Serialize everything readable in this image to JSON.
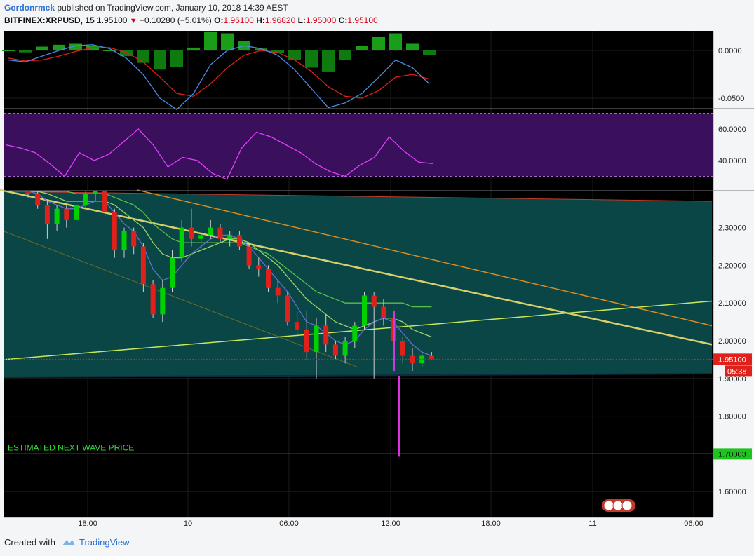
{
  "header": {
    "author": "Gordonrmck",
    "published_text": "published on TradingView.com, January 10, 2018 14:39 AEST",
    "symbol": "BITFINEX:XRPUSD, 15",
    "last": "1.95100",
    "change": "−0.10280 (−5.01%)",
    "o_label": "O:",
    "o_value": "1.96100",
    "h_label": "H:",
    "h_value": "1.96820",
    "l_label": "L:",
    "l_value": "1.95000",
    "c_label": "C:",
    "c_value": "1.95100"
  },
  "footer": {
    "created_with": "Created with",
    "brand": "TradingView"
  },
  "colors": {
    "up": "#00d100",
    "down": "#e0201b",
    "macd_line": "#4a8be0",
    "signal_line": "#e0201b",
    "hist": "#1a9e1a",
    "rsi": "#e040fb",
    "rsi_band": "#3a0f5c",
    "channel_fill": "#0b4a4a",
    "price_tag": "#e0201b",
    "target_tag": "#1ec41e"
  },
  "macd_pane": {
    "ticks": [
      "0.0000",
      "-0.0500"
    ],
    "macd": [
      -0.01,
      -0.012,
      -0.006,
      0.0,
      0.005,
      0.006,
      0.002,
      -0.008,
      -0.025,
      -0.05,
      -0.062,
      -0.045,
      -0.015,
      0.0,
      0.005,
      0.002,
      -0.005,
      -0.02,
      -0.04,
      -0.06,
      -0.055,
      -0.045,
      -0.028,
      -0.01,
      -0.018,
      -0.035
    ],
    "signal": [
      -0.008,
      -0.011,
      -0.01,
      -0.006,
      -0.001,
      0.003,
      0.003,
      -0.002,
      -0.012,
      -0.028,
      -0.045,
      -0.048,
      -0.035,
      -0.018,
      -0.005,
      0.0,
      -0.002,
      -0.01,
      -0.022,
      -0.038,
      -0.048,
      -0.05,
      -0.042,
      -0.028,
      -0.025,
      -0.03
    ],
    "hist": [
      0.0,
      -0.002,
      0.004,
      0.006,
      0.007,
      0.005,
      0.0,
      -0.006,
      -0.013,
      -0.02,
      -0.017,
      0.003,
      0.02,
      0.018,
      0.01,
      0.002,
      -0.003,
      -0.01,
      -0.018,
      -0.022,
      -0.01,
      0.005,
      0.014,
      0.018,
      0.007,
      -0.005
    ]
  },
  "rsi_pane": {
    "ticks": [
      "60.0000",
      "40.0000"
    ],
    "values": [
      50,
      48,
      45,
      38,
      30,
      45,
      40,
      44,
      52,
      60,
      50,
      36,
      42,
      40,
      32,
      28,
      48,
      58,
      55,
      50,
      45,
      38,
      33,
      30,
      37,
      42,
      55,
      46,
      39,
      38
    ]
  },
  "chart_data": {
    "type": "candlestick",
    "title": "BITFINEX:XRPUSD, 15",
    "ylim": [
      1.52,
      2.4
    ],
    "yticks": [
      "2.30000",
      "2.20000",
      "2.10000",
      "2.00000",
      "1.90000",
      "1.80000",
      "1.70000",
      "1.60000"
    ],
    "xticks": [
      "18:00",
      "10",
      "06:00",
      "12:00",
      "18:00",
      "11",
      "06:00"
    ],
    "current_price_label": "1.95100",
    "countdown_label": "05:38",
    "target": {
      "price": 1.70003,
      "label": "1.70003",
      "annotation": "ESTIMATED NEXT WAVE PRICE"
    },
    "candles": [
      [
        2.4,
        2.41,
        2.38,
        2.39
      ],
      [
        2.39,
        2.4,
        2.35,
        2.36
      ],
      [
        2.36,
        2.37,
        2.27,
        2.31
      ],
      [
        2.31,
        2.36,
        2.29,
        2.35
      ],
      [
        2.35,
        2.36,
        2.3,
        2.32
      ],
      [
        2.32,
        2.37,
        2.31,
        2.36
      ],
      [
        2.36,
        2.4,
        2.35,
        2.39
      ],
      [
        2.39,
        2.41,
        2.37,
        2.4
      ],
      [
        2.4,
        2.41,
        2.33,
        2.34
      ],
      [
        2.34,
        2.35,
        2.22,
        2.24
      ],
      [
        2.24,
        2.3,
        2.22,
        2.29
      ],
      [
        2.29,
        2.3,
        2.23,
        2.25
      ],
      [
        2.25,
        2.26,
        2.13,
        2.15
      ],
      [
        2.15,
        2.16,
        2.06,
        2.07
      ],
      [
        2.07,
        2.16,
        2.05,
        2.14
      ],
      [
        2.14,
        2.24,
        2.13,
        2.22
      ],
      [
        2.22,
        2.32,
        2.21,
        2.3
      ],
      [
        2.3,
        2.35,
        2.25,
        2.27
      ],
      [
        2.27,
        2.29,
        2.24,
        2.28
      ],
      [
        2.28,
        2.32,
        2.27,
        2.3
      ],
      [
        2.3,
        2.31,
        2.26,
        2.27
      ],
      [
        2.27,
        2.29,
        2.25,
        2.28
      ],
      [
        2.28,
        2.29,
        2.24,
        2.25
      ],
      [
        2.25,
        2.26,
        2.19,
        2.2
      ],
      [
        2.2,
        2.22,
        2.17,
        2.19
      ],
      [
        2.19,
        2.2,
        2.13,
        2.14
      ],
      [
        2.14,
        2.16,
        2.1,
        2.12
      ],
      [
        2.12,
        2.13,
        2.04,
        2.05
      ],
      [
        2.05,
        2.08,
        2.01,
        2.03
      ],
      [
        2.03,
        2.08,
        1.95,
        1.97
      ],
      [
        1.97,
        2.06,
        1.9,
        2.04
      ],
      [
        2.04,
        2.07,
        1.97,
        1.99
      ],
      [
        1.99,
        2.0,
        1.95,
        1.96
      ],
      [
        1.96,
        2.01,
        1.94,
        2.0
      ],
      [
        2.0,
        2.05,
        1.98,
        2.04
      ],
      [
        2.04,
        2.13,
        2.03,
        2.12
      ],
      [
        2.12,
        2.13,
        1.9,
        2.09
      ],
      [
        2.09,
        2.11,
        2.04,
        2.06
      ],
      [
        2.06,
        2.07,
        1.99,
        2.0
      ],
      [
        2.0,
        2.01,
        1.94,
        1.96
      ],
      [
        1.96,
        1.98,
        1.92,
        1.94
      ],
      [
        1.94,
        1.97,
        1.93,
        1.96
      ],
      [
        1.96,
        1.97,
        1.95,
        1.951
      ]
    ],
    "ma_fast": [
      2.4,
      2.39,
      2.37,
      2.36,
      2.35,
      2.35,
      2.36,
      2.37,
      2.37,
      2.34,
      2.31,
      2.29,
      2.25,
      2.19,
      2.16,
      2.17,
      2.2,
      2.23,
      2.25,
      2.27,
      2.28,
      2.28,
      2.27,
      2.25,
      2.22,
      2.19,
      2.16,
      2.13,
      2.09,
      2.05,
      2.04,
      2.02,
      2.0,
      1.99,
      2.0,
      2.03,
      2.05,
      2.06,
      2.05,
      2.02,
      1.99,
      1.97,
      1.96
    ],
    "ma_mid": [
      2.41,
      2.4,
      2.39,
      2.38,
      2.37,
      2.37,
      2.37,
      2.37,
      2.37,
      2.36,
      2.34,
      2.32,
      2.3,
      2.26,
      2.23,
      2.22,
      2.22,
      2.23,
      2.24,
      2.25,
      2.26,
      2.27,
      2.27,
      2.26,
      2.24,
      2.22,
      2.2,
      2.17,
      2.14,
      2.11,
      2.09,
      2.07,
      2.05,
      2.04,
      2.03,
      2.04,
      2.05,
      2.06,
      2.06,
      2.05,
      2.03,
      2.02,
      2.01
    ],
    "ma_slow": [
      2.42,
      2.42,
      2.41,
      2.4,
      2.4,
      2.39,
      2.39,
      2.39,
      2.39,
      2.38,
      2.37,
      2.36,
      2.34,
      2.31,
      2.29,
      2.27,
      2.26,
      2.26,
      2.26,
      2.26,
      2.26,
      2.26,
      2.26,
      2.25,
      2.24,
      2.23,
      2.21,
      2.19,
      2.17,
      2.15,
      2.13,
      2.12,
      2.11,
      2.1,
      2.1,
      2.1,
      2.1,
      2.1,
      2.1,
      2.1,
      2.09,
      2.09,
      2.09
    ],
    "downtrend_yellow": [
      [
        0,
        2.4
      ],
      [
        1015,
        1.99
      ]
    ],
    "downtrend_orange": [
      [
        195,
        2.4
      ],
      [
        1015,
        2.04
      ]
    ],
    "uptrend_green": [
      [
        6,
        1.95
      ],
      [
        1015,
        2.105
      ]
    ],
    "lower_channel_line": [
      [
        6,
        2.29
      ],
      [
        510,
        1.93
      ]
    ],
    "purple_marker": {
      "price_top": 2.08,
      "price_bottom": 1.7
    }
  }
}
